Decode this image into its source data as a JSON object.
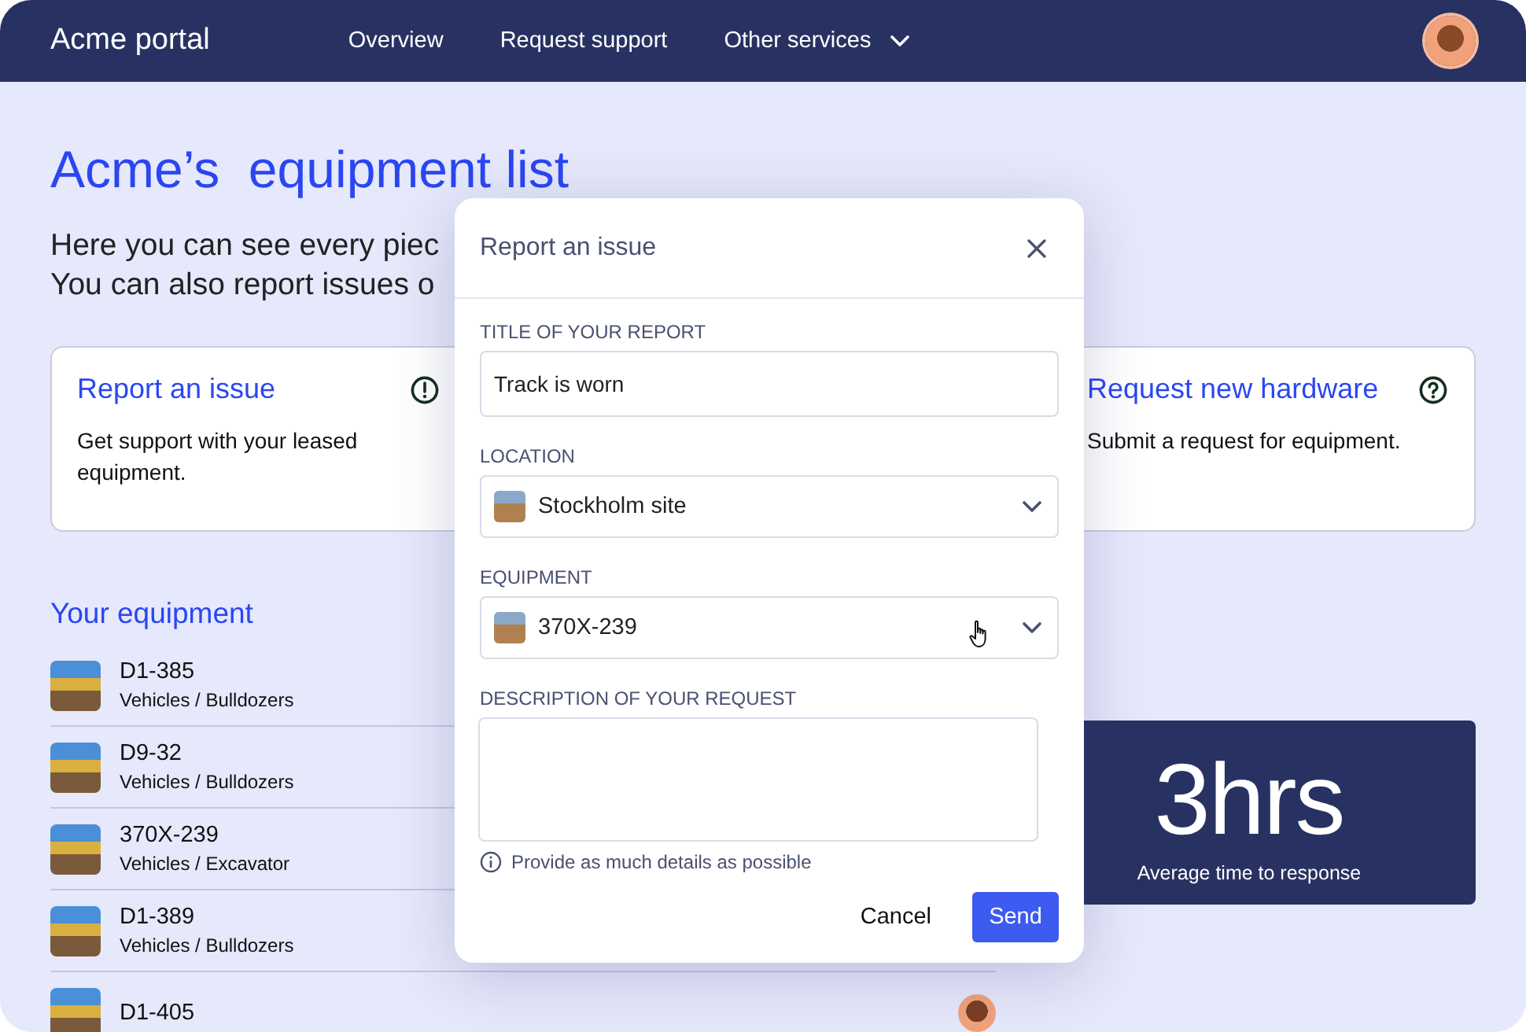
{
  "nav": {
    "brand": "Acme portal",
    "links": [
      {
        "label": "Overview",
        "has_menu": false
      },
      {
        "label": "Request support",
        "has_menu": false
      },
      {
        "label": "Other services",
        "has_menu": true
      }
    ]
  },
  "page": {
    "title": "Acme’s  equipment list",
    "intro_lines": [
      "Here you can see every piec",
      "You can also report issues o"
    ]
  },
  "cards": [
    {
      "kind": "issue",
      "title": "Report an issue",
      "text": "Get support with your  leased equipment."
    },
    {
      "kind": "request",
      "title": "Request new hardware",
      "text": "Submit a request for equipment."
    }
  ],
  "equipment": {
    "heading": "Your equipment",
    "rows": [
      {
        "name": "D1-385",
        "category": "Vehicles / Bulldozers",
        "assignee_avatar": false
      },
      {
        "name": "D9-32",
        "category": "Vehicles / Bulldozers",
        "assignee_avatar": false
      },
      {
        "name": "370X-239",
        "category": "Vehicles / Excavator",
        "assignee_avatar": false
      },
      {
        "name": "D1-389",
        "category": "Vehicles / Bulldozers",
        "assignee_avatar": false
      },
      {
        "name": "D1-405",
        "assignee_avatar": true
      }
    ]
  },
  "stat": {
    "value": "3hrs",
    "label": "Average time to response"
  },
  "dialog": {
    "title": "Report an issue",
    "fields": [
      {
        "kind": "text",
        "label": "TITLE OF YOUR REPORT",
        "value": "Track is worn"
      },
      {
        "kind": "select",
        "label": "LOCATION",
        "value": "Stockholm site",
        "hovered": false
      },
      {
        "kind": "select",
        "label": "EQUIPMENT",
        "value": "370X-239",
        "hovered": true
      },
      {
        "kind": "textarea",
        "label": "DESCRIPTION OF YOUR REQUEST",
        "hint": "Provide as much details as possible"
      }
    ],
    "buttons": [
      {
        "kind": "secondary",
        "label": "Cancel"
      },
      {
        "kind": "primary",
        "label": "Send"
      }
    ]
  }
}
